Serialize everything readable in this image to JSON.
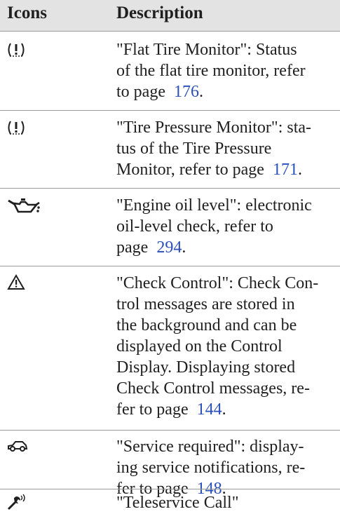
{
  "header": {
    "col_icons": "Icons",
    "col_description": "Description"
  },
  "rows": [
    {
      "icon": "flat-tire-warning-icon",
      "lines": [
        "\"Flat Tire Monitor\": Status",
        "of the flat tire monitor, refer",
        "to page"
      ],
      "page": "176",
      "after": "."
    },
    {
      "icon": "tire-pressure-warning-icon",
      "lines": [
        "\"Tire Pressure Monitor\": sta-",
        "tus of the Tire Pressure",
        "Monitor, refer to page"
      ],
      "page": "171",
      "after": "."
    },
    {
      "icon": "oil-can-icon",
      "lines": [
        "\"Engine oil level\": electronic",
        "oil-level check, refer to",
        "page"
      ],
      "page": "294",
      "after": "."
    },
    {
      "icon": "warning-triangle-icon",
      "lines": [
        "\"Check Control\": Check Con-",
        "trol messages are stored in",
        "the background and can be",
        "displayed on the Control",
        "Display. Displaying stored",
        "Check Control messages, re-",
        "fer to page"
      ],
      "page": "144",
      "after": "."
    },
    {
      "icon": "car-service-icon",
      "lines": [
        "\"Service required\": display-",
        "ing service notifications, re-",
        "fer to page"
      ],
      "page": "148",
      "after": "."
    },
    {
      "icon": "teleservice-wrench-icon",
      "lines": [
        "\"Teleservice Call\""
      ]
    }
  ]
}
